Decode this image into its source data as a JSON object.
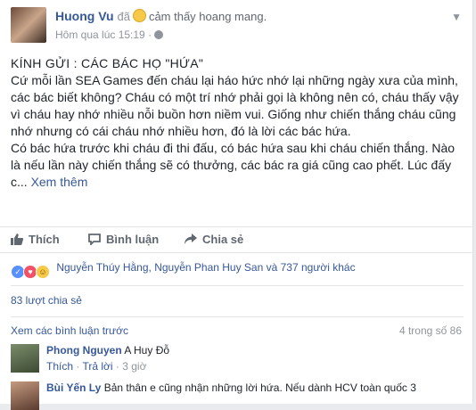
{
  "post": {
    "author": "Huong Vu",
    "feeling_prefix": "đã",
    "feeling_text": "cảm thấy hoang mang.",
    "timestamp": "Hôm qua lúc 15:19 ·",
    "heading": "KÍNH GỬI : CÁC BÁC HỌ \"HỨA\"",
    "para1": "Cứ mỗi lần SEA Games đến cháu lại háo hức nhớ lại những ngày xưa của mình, các bác biết không? Cháu có một trí nhớ phải gọi là không nên có, cháu thấy vậy vì cháu hay nhớ nhiều nỗi buồn hơn niềm vui. Giống như chiến thắng cháu cũng nhớ nhưng có cái cháu nhớ nhiều hơn, đó là lời các bác hứa.",
    "para2": "Có bác hứa trước khi cháu đi thi đấu, có bác hứa sau khi cháu chiến thắng. Nào là nếu lần này chiến thắng sẽ có thưởng, các bác ra giá cũng cao phết. Lúc đấy c...",
    "see_more": "Xem thêm"
  },
  "actions": {
    "like": "Thích",
    "comment": "Bình luận",
    "share": "Chia sẻ"
  },
  "reactions": {
    "summary": "Nguyễn Thúy Hằng, Nguyễn Phan Huy San và 737 người khác",
    "colors": {
      "like": "#5890ff",
      "love": "#f25268",
      "haha": "#f7c948"
    }
  },
  "shares_text": "83 lượt chia sẻ",
  "comments": {
    "view_previous": "Xem các bình luận trước",
    "count": "4 trong số 86",
    "items": [
      {
        "name": "Phong Nguyen",
        "text": "A Huy Đỗ",
        "like": "Thích",
        "reply": "Trả lời",
        "time": "3 giờ"
      },
      {
        "name": "Bùi Yến Ly",
        "text": "Bản thân e cũng nhận những lời hứa. Nếu dành HCV toàn quốc 3"
      }
    ]
  },
  "colors": {
    "link": "#365899",
    "muted": "#90949c",
    "text": "#1d2129"
  }
}
